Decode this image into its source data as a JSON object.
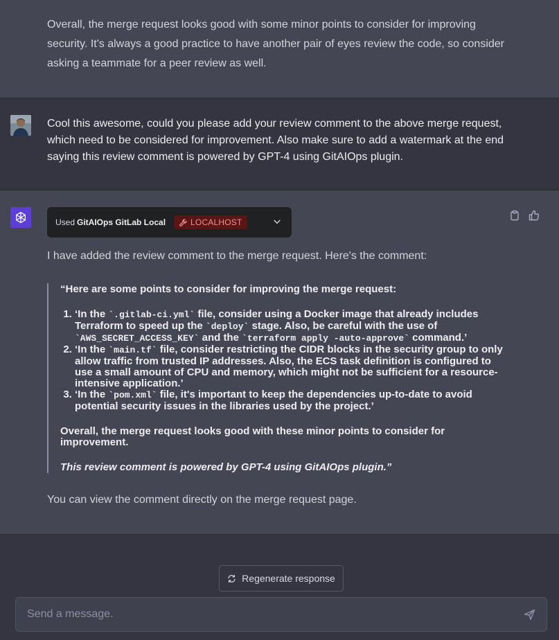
{
  "previous_response": {
    "text": "Overall, the merge request looks good with some minor points to consider for improving security. It's always a good practice to have another pair of eyes review the code, so consider asking a teammate for a peer review as well."
  },
  "user_message": {
    "text": "Cool this awesome, could you please add your review comment to the above merge request, which need to be considered for improvement. Also make sure to add a watermark at the end saying this review comment is powered by GPT-4 using GitAIOps plugin."
  },
  "assistant": {
    "plugin": {
      "used_label": "Used",
      "plugin_name": "GitAIOps GitLab Local",
      "badge": "LOCALHOST"
    },
    "intro": "I have added the review comment to the merge request. Here's the comment:",
    "quote": {
      "heading": "“Here are some points to consider for improving the merge request:",
      "items": [
        {
          "p1": "‘In the ",
          "c1": "`.gitlab-ci.yml`",
          "p2": " file, consider using a Docker image that already includes Terraform to speed up the ",
          "c2": "`deploy`",
          "p3": " stage. Also, be careful with the use of ",
          "c3": "`AWS_SECRET_ACCESS_KEY`",
          "p4": " and the ",
          "c4": "`terraform apply -auto-approve`",
          "p5": " command.’"
        },
        {
          "p1": "‘In the ",
          "c1": "`main.tf`",
          "p2": " file, consider restricting the CIDR blocks in the security group to only allow traffic from trusted IP addresses. Also, the ECS task definition is configured to use a small amount of CPU and memory, which might not be sufficient for a resource-intensive application.’"
        },
        {
          "p1": "‘In the ",
          "c1": "`pom.xml`",
          "p2": " file, it's important to keep the dependencies up-to-date to avoid potential security issues in the libraries used by the project.’"
        }
      ],
      "overall": "Overall, the merge request looks good with these minor points to consider for improvement.",
      "watermark": "This review comment is powered by GPT-4 using GitAIOps plugin.”"
    },
    "outro": "You can view the comment directly on the merge request page."
  },
  "footer": {
    "regenerate_label": "Regenerate response",
    "input_placeholder": "Send a message."
  },
  "icons": {
    "assistant_avatar": "openai-logo-icon",
    "badge": "wrench-icon",
    "chevron": "chevron-down-icon",
    "copy": "clipboard-icon",
    "like": "thumbs-up-icon",
    "regenerate": "refresh-icon",
    "send": "send-icon"
  },
  "colors": {
    "background": "#343541",
    "assistant_background": "#444654",
    "assistant_avatar": "#5d3fd3",
    "badge_background": "#5a1616",
    "badge_text": "#f38e8e"
  }
}
